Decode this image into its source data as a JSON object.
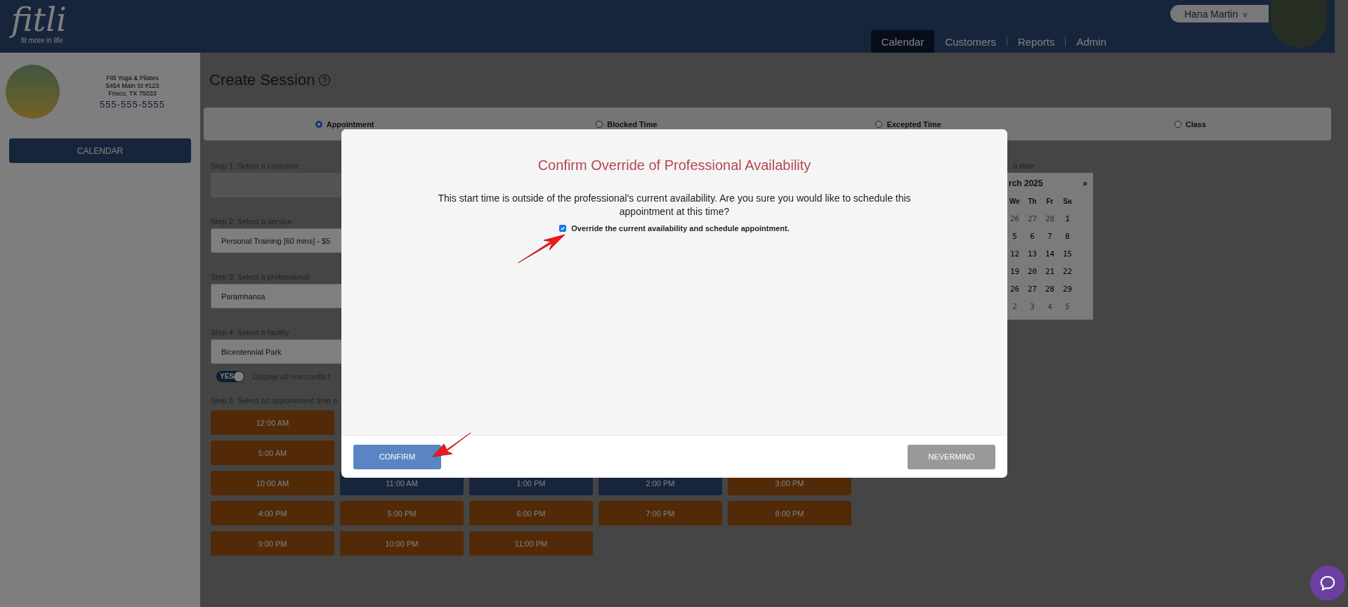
{
  "header": {
    "logo": {
      "wordmark": "fitli",
      "tagline": "fit more in life"
    },
    "user": {
      "name": "Hana Martin",
      "menu_glyph": "»"
    },
    "nav": [
      {
        "label": "Calendar",
        "selected": true
      },
      {
        "label": "Customers",
        "selected": false
      },
      {
        "label": "Reports",
        "selected": false
      },
      {
        "label": "Admin",
        "selected": false
      }
    ]
  },
  "sidebar": {
    "business": {
      "name": "Fitli Yoga & Pilates",
      "street": "5454 Main St #123",
      "city": "Frisco, TX 75033",
      "phone": "555-555-5555"
    },
    "button": "CALENDAR"
  },
  "page": {
    "title": "Create Session",
    "session_types": [
      {
        "label": "Appointment",
        "selected": true
      },
      {
        "label": "Blocked Time",
        "selected": false
      },
      {
        "label": "Excepted Time",
        "selected": false
      },
      {
        "label": "Class",
        "selected": false
      }
    ],
    "steps": [
      {
        "label": "Step 1: Select a customer",
        "disabled": true
      },
      {
        "label": "Step 2: Select a service",
        "value": "Personal Training [60 mins] - $5",
        "disabled": false
      },
      {
        "label": "Step 3: Select a professional",
        "value": "Paramhansa",
        "disabled": false
      },
      {
        "label": "Step 4: Select a facility",
        "value": "Bicentennial Park",
        "disabled": false
      }
    ],
    "toggle": {
      "on": true,
      "label": "YES",
      "text": "Display all non-conflict"
    },
    "time_step_label": "Step 5: Select an appointment time o",
    "time_rows": [
      [
        {
          "time": "12:00 AM",
          "highlighted": false
        }
      ],
      [
        {
          "time": "5:00 AM",
          "highlighted": false
        }
      ],
      [
        {
          "time": "10:00 AM",
          "highlighted": false
        },
        {
          "time": "11:00 AM",
          "highlighted": true
        },
        {
          "time": "1:00 PM",
          "highlighted": true
        },
        {
          "time": "2:00 PM",
          "highlighted": true
        },
        {
          "time": "3:00 PM",
          "highlighted": false
        }
      ],
      [
        {
          "time": "4:00 PM",
          "highlighted": false
        },
        {
          "time": "5:00 PM",
          "highlighted": false
        },
        {
          "time": "6:00 PM",
          "highlighted": false
        },
        {
          "time": "7:00 PM",
          "highlighted": false
        },
        {
          "time": "8:00 PM",
          "highlighted": false
        }
      ],
      [
        {
          "time": "9:00 PM",
          "highlighted": false
        },
        {
          "time": "10:00 PM",
          "highlighted": false
        },
        {
          "time": "11:00 PM",
          "highlighted": false
        }
      ]
    ],
    "calendar": {
      "label": "a date",
      "month": "rch 2025",
      "next": "»",
      "weekdays": [
        "We",
        "Th",
        "Fr",
        "Sa"
      ],
      "weeks": [
        [
          {
            "day": "26",
            "muted": true
          },
          {
            "day": "27",
            "muted": true
          },
          {
            "day": "28",
            "muted": true
          },
          {
            "day": "1",
            "muted": false
          }
        ],
        [
          {
            "day": "5",
            "muted": false
          },
          {
            "day": "6",
            "muted": false
          },
          {
            "day": "7",
            "muted": false
          },
          {
            "day": "8",
            "muted": false
          }
        ],
        [
          {
            "day": "12",
            "muted": false
          },
          {
            "day": "13",
            "muted": false
          },
          {
            "day": "14",
            "muted": false
          },
          {
            "day": "15",
            "muted": false
          }
        ],
        [
          {
            "day": "19",
            "muted": false
          },
          {
            "day": "20",
            "muted": false
          },
          {
            "day": "21",
            "muted": false
          },
          {
            "day": "22",
            "muted": false
          }
        ],
        [
          {
            "day": "26",
            "muted": false
          },
          {
            "day": "27",
            "muted": false
          },
          {
            "day": "28",
            "muted": false
          },
          {
            "day": "29",
            "muted": false
          }
        ],
        [
          {
            "day": "2",
            "muted": true
          },
          {
            "day": "3",
            "muted": true
          },
          {
            "day": "4",
            "muted": true
          },
          {
            "day": "5",
            "muted": true
          }
        ]
      ]
    }
  },
  "modal": {
    "title": "Confirm Override of Professional Availability",
    "message": "This start time is outside of the professional's current availability. Are you sure you would like to schedule this appointment at this time?",
    "checkbox": {
      "label": "Override the current availability and schedule appointment.",
      "checked": true
    },
    "confirm": "CONFIRM",
    "cancel": "NEVERMIND"
  }
}
